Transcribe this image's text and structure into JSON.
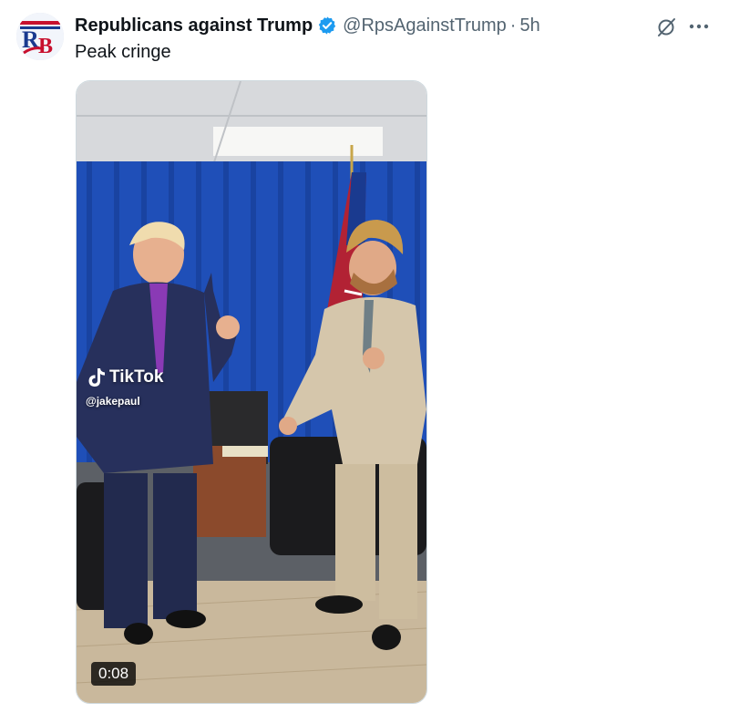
{
  "tweet": {
    "author_name": "Republicans against Trump",
    "handle": "@RpsAgainstTrump",
    "separator": "·",
    "time": "5h",
    "text": "Peak cringe",
    "verified": true
  },
  "icons": {
    "avatar": "rb-logo-avatar",
    "verified": "verified-badge-icon",
    "grok": "grok-icon",
    "more": "more-icon"
  },
  "media": {
    "watermark_brand": "TikTok",
    "watermark_user": "@jakepaul",
    "duration": "0:08"
  },
  "colors": {
    "verified_blue": "#1d9bf0",
    "secondary_text": "#536471",
    "curtain_blue": "#1f4fb8"
  }
}
